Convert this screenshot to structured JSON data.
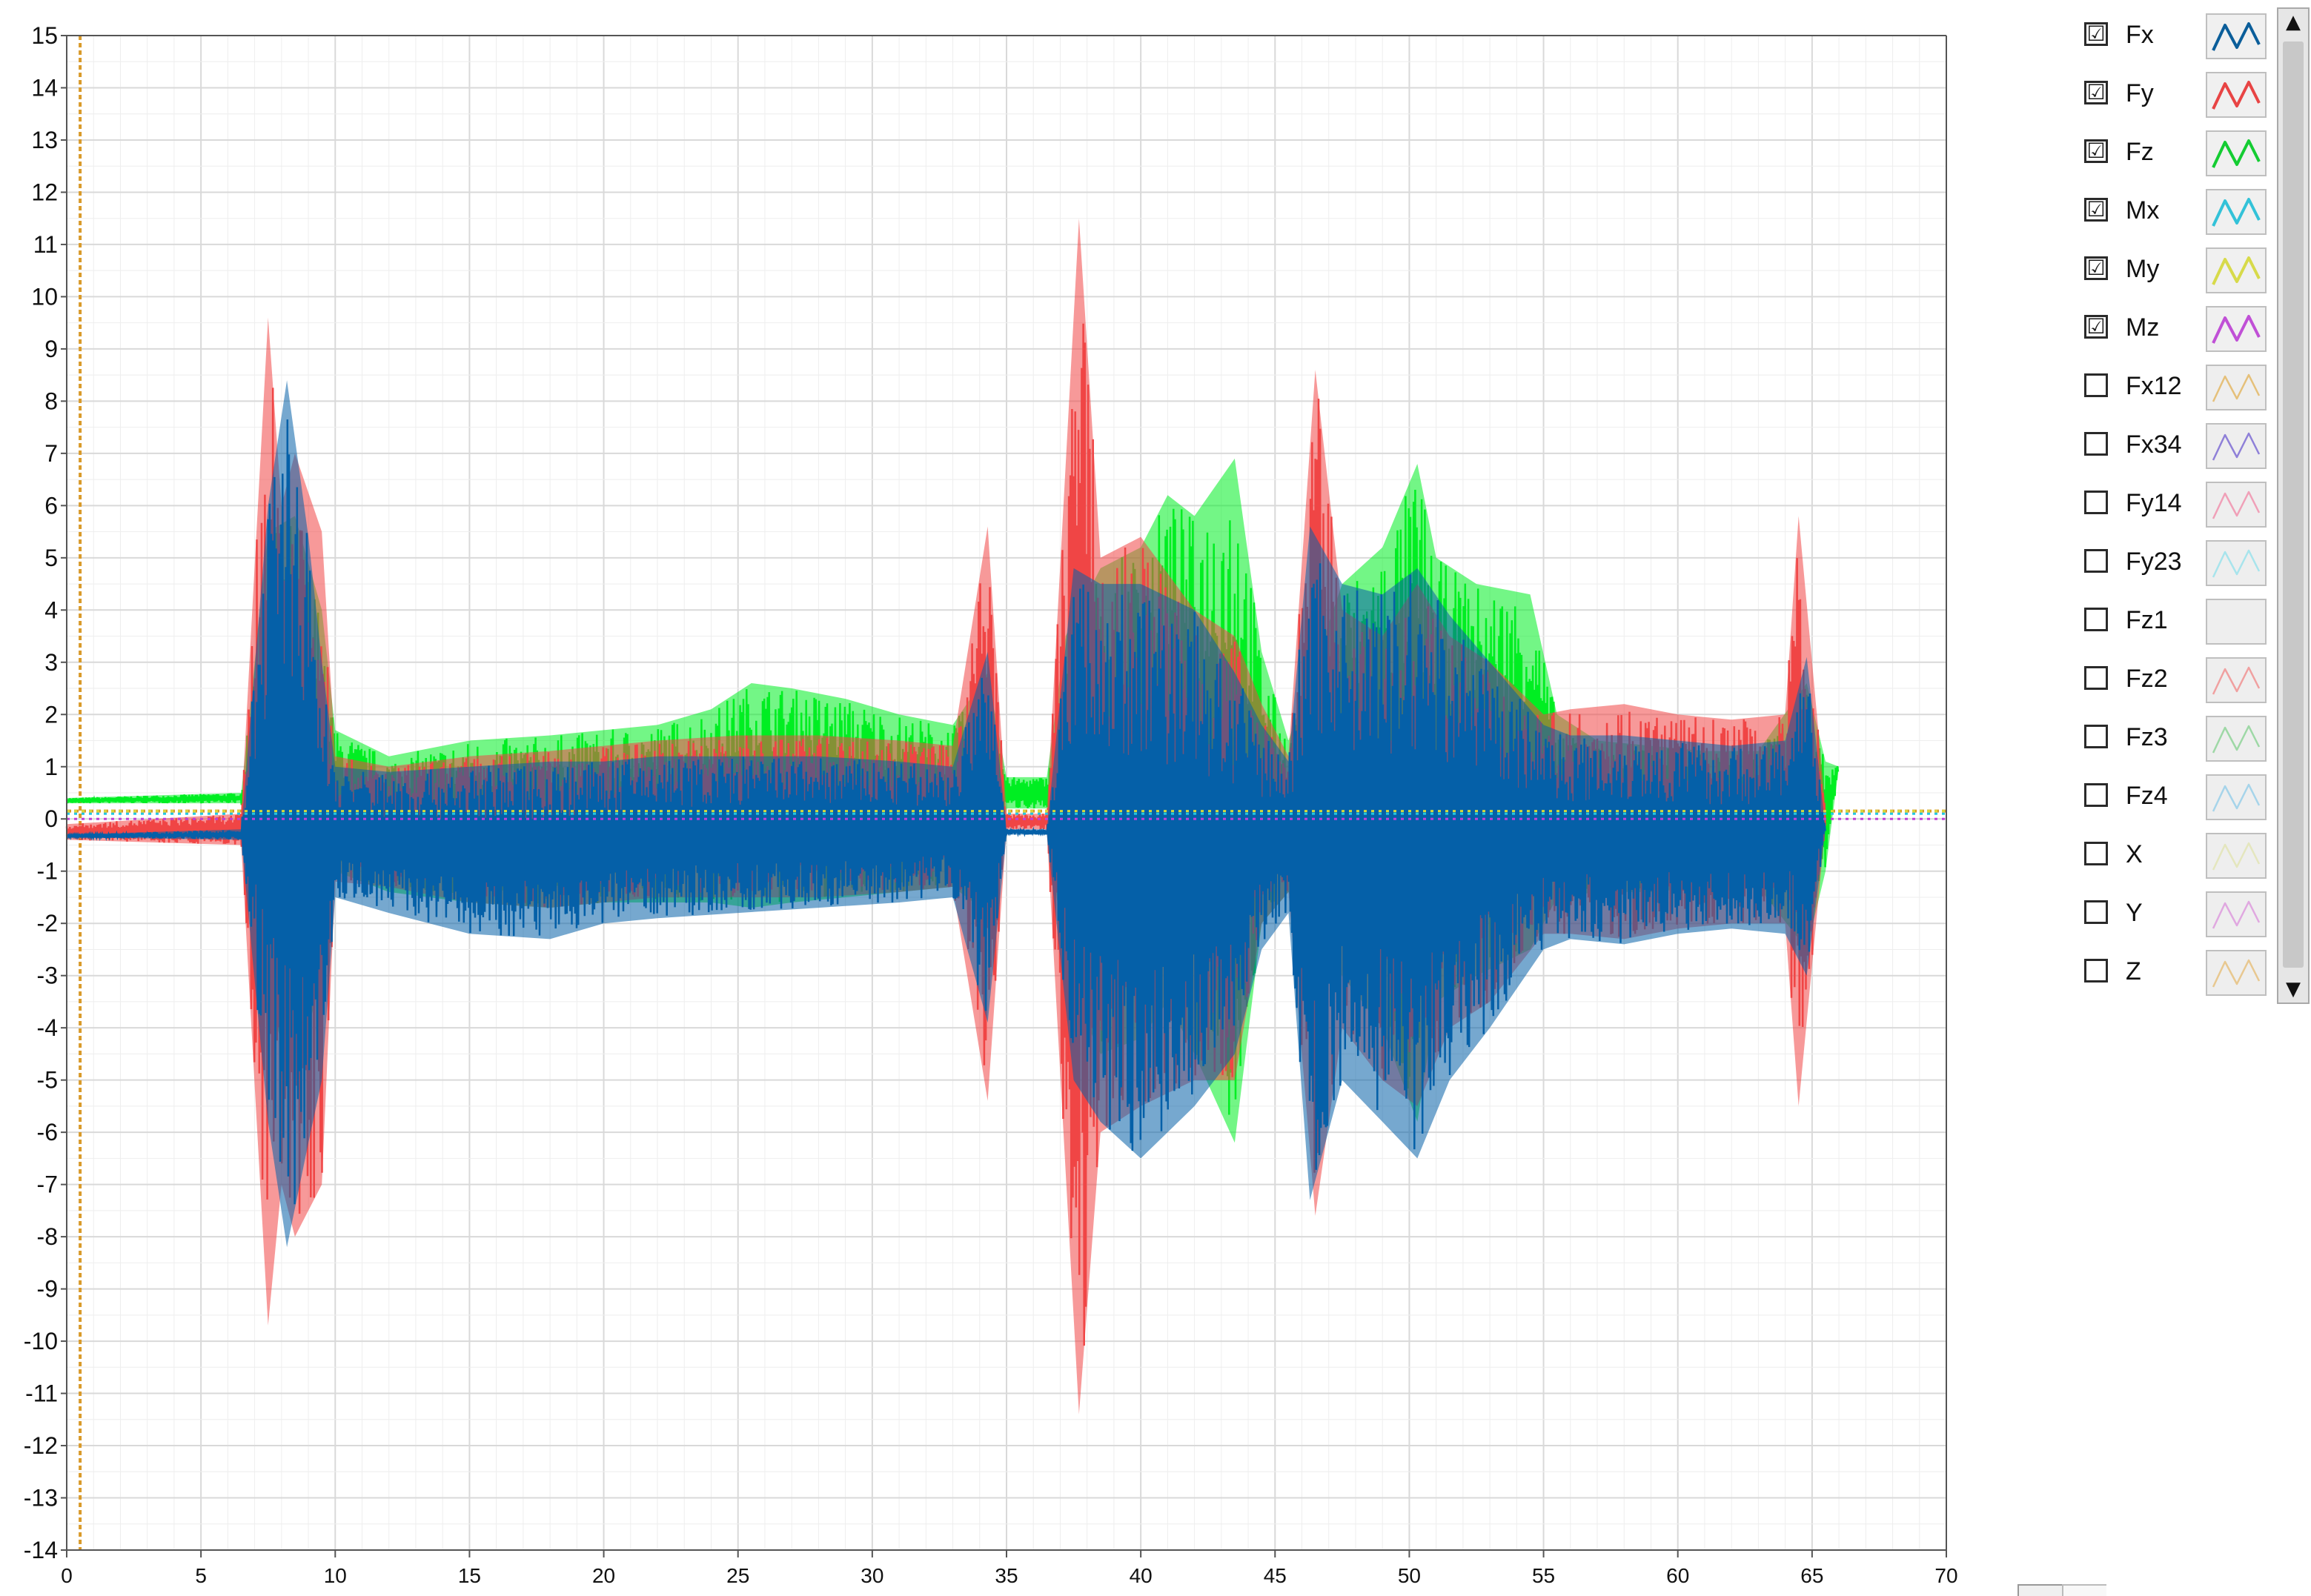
{
  "chart_data": {
    "type": "line",
    "title": "",
    "xlabel": "",
    "ylabel": "",
    "xlim": [
      0,
      70
    ],
    "ylim": [
      -14,
      15
    ],
    "x_ticks": [
      "0",
      "5",
      "10",
      "15",
      "20",
      "25",
      "30",
      "35",
      "40",
      "45",
      "50",
      "55",
      "60",
      "65",
      "70"
    ],
    "y_ticks": [
      "15",
      "14",
      "13",
      "12",
      "11",
      "10",
      "9",
      "8",
      "7",
      "6",
      "5",
      "4",
      "3",
      "2",
      "1",
      "0",
      "-1",
      "-2",
      "-3",
      "-4",
      "-5",
      "-6",
      "-7",
      "-8",
      "-9",
      "-10",
      "-11",
      "-12",
      "-13",
      "-14"
    ],
    "grid": true,
    "legend_position": "right",
    "series": [
      {
        "name": "Fz",
        "color": "#00ee22",
        "x": [
          0,
          6.5,
          7.5,
          8.5,
          9.5,
          10,
          12,
          15,
          18,
          20,
          22,
          24,
          25.5,
          27,
          29,
          31,
          33,
          34.3,
          35,
          36.5,
          37.2,
          38.5,
          40,
          41,
          42,
          43.5,
          44.5,
          45.5,
          46.5,
          47.5,
          49,
          50.3,
          51,
          52.5,
          54.5,
          55.5,
          57,
          59,
          61,
          63,
          64.8,
          65.5,
          66
        ],
        "upper": [
          0.4,
          0.5,
          5.5,
          5.8,
          4.0,
          1.7,
          1.2,
          1.5,
          1.6,
          1.7,
          1.8,
          2.1,
          2.6,
          2.5,
          2.3,
          2.0,
          1.8,
          2.8,
          0.8,
          0.8,
          3.5,
          4.8,
          5.2,
          6.2,
          5.8,
          6.9,
          3.2,
          1.5,
          3.0,
          4.5,
          5.2,
          6.8,
          5.0,
          4.5,
          4.3,
          2.0,
          1.5,
          1.4,
          1.3,
          1.3,
          2.6,
          1.1,
          1.0
        ],
        "lower": [
          0.3,
          0.3,
          -3.5,
          -5.0,
          -3.0,
          -1.0,
          -1.4,
          -1.6,
          -1.7,
          -1.6,
          -1.6,
          -1.6,
          -1.7,
          -1.6,
          -1.5,
          -1.4,
          -1.3,
          -1.8,
          0.2,
          0.2,
          -3.0,
          -4.5,
          -4.2,
          -3.5,
          -4.5,
          -6.2,
          -2.0,
          -1.4,
          -2.5,
          -3.0,
          -4.0,
          -5.8,
          -3.5,
          -3.0,
          -2.5,
          -1.5,
          -1.4,
          -1.4,
          -1.3,
          -1.3,
          -2.5,
          -1.0,
          1.0
        ]
      },
      {
        "name": "Fy",
        "color": "#f04545",
        "x": [
          0,
          6.5,
          7.5,
          8,
          8.5,
          9.5,
          10,
          12,
          15,
          18,
          20,
          22,
          25,
          28,
          31,
          33,
          34.3,
          35,
          36.5,
          37.7,
          38.5,
          40,
          42,
          43.5,
          44.5,
          45.5,
          46.5,
          47.5,
          49,
          50.3,
          51.5,
          53,
          55,
          56,
          58,
          60,
          62,
          64,
          64.5,
          65.5
        ],
        "upper": [
          -0.1,
          0.1,
          9.6,
          6.0,
          7.0,
          5.5,
          1.2,
          1.0,
          1.2,
          1.3,
          1.4,
          1.5,
          1.6,
          1.6,
          1.5,
          1.4,
          5.6,
          0.1,
          0.1,
          11.5,
          5.0,
          5.4,
          4.0,
          3.5,
          2.2,
          1.2,
          8.6,
          4.0,
          3.5,
          4.5,
          3.5,
          3.0,
          2.0,
          2.1,
          2.2,
          2.0,
          1.9,
          2.0,
          5.8,
          0.2
        ],
        "lower": [
          -0.4,
          -0.5,
          -9.7,
          -7.0,
          -8.0,
          -7.0,
          -1.2,
          -1.3,
          -1.6,
          -1.7,
          -1.6,
          -1.5,
          -1.5,
          -1.5,
          -1.4,
          -1.3,
          -5.4,
          -0.2,
          -0.2,
          -11.4,
          -6.0,
          -5.5,
          -5.0,
          -5.0,
          -2.0,
          -1.4,
          -7.6,
          -4.0,
          -5.0,
          -5.5,
          -4.0,
          -3.5,
          -2.2,
          -2.2,
          -2.3,
          -2.1,
          -2.0,
          -2.0,
          -5.5,
          -0.1
        ]
      },
      {
        "name": "Fx",
        "color": "#0660a8",
        "x": [
          0,
          6.5,
          7.5,
          8.2,
          9,
          9.5,
          10,
          12,
          15,
          18,
          20,
          22,
          25,
          28,
          31,
          33,
          34.3,
          35,
          36.5,
          37.5,
          38.5,
          40,
          42,
          43.5,
          44.5,
          45.5,
          46.3,
          47.5,
          49,
          50.3,
          51.5,
          53,
          55,
          56,
          58,
          60,
          62,
          64,
          64.8,
          65.5
        ],
        "upper": [
          -0.3,
          -0.2,
          6.0,
          8.4,
          5.4,
          3.0,
          1.0,
          0.9,
          1.0,
          1.1,
          1.1,
          1.2,
          1.2,
          1.2,
          1.1,
          1.0,
          3.2,
          -0.2,
          -0.2,
          4.8,
          4.5,
          4.5,
          4.0,
          2.8,
          1.8,
          1.1,
          5.6,
          4.5,
          4.3,
          4.8,
          3.9,
          3.0,
          1.8,
          1.6,
          1.6,
          1.5,
          1.4,
          1.5,
          3.1,
          -0.2
        ],
        "lower": [
          -0.35,
          -0.4,
          -5.8,
          -8.2,
          -6.2,
          -5.0,
          -1.5,
          -1.8,
          -2.2,
          -2.3,
          -2.0,
          -1.9,
          -1.8,
          -1.7,
          -1.6,
          -1.5,
          -3.9,
          -0.3,
          -0.3,
          -5.0,
          -5.8,
          -6.5,
          -5.5,
          -4.5,
          -2.5,
          -1.8,
          -7.3,
          -5.0,
          -5.8,
          -6.5,
          -5.0,
          -4.0,
          -2.5,
          -2.3,
          -2.4,
          -2.2,
          -2.1,
          -2.2,
          -3.0,
          -0.2
        ]
      },
      {
        "name": "Mx",
        "color": "#22c8e0",
        "x": [
          0,
          70
        ],
        "upper": [
          0.1,
          0.1
        ],
        "lower": [
          0.1,
          0.1
        ]
      },
      {
        "name": "My",
        "color": "#d7d83a",
        "x": [
          0,
          70
        ],
        "upper": [
          0.15,
          0.15
        ],
        "lower": [
          0.15,
          0.15
        ]
      },
      {
        "name": "Mz",
        "color": "#c040d8",
        "x": [
          0,
          70
        ],
        "upper": [
          0.0,
          0.0
        ],
        "lower": [
          0.0,
          0.0
        ]
      }
    ]
  },
  "legend": {
    "items": [
      {
        "label": "Fx",
        "checked": true,
        "check_glyph": "☑",
        "color": "#0b5e9a",
        "swatch_bg": "#f0f0f0",
        "icon": "wave-swatch-icon"
      },
      {
        "label": "Fy",
        "checked": true,
        "check_glyph": "☑",
        "color": "#e84444",
        "swatch_bg": "#f0f0f0",
        "icon": "wave-swatch-icon"
      },
      {
        "label": "Fz",
        "checked": true,
        "check_glyph": "☑",
        "color": "#14cc32",
        "swatch_bg": "#f0f0f0",
        "icon": "wave-swatch-icon"
      },
      {
        "label": "Mx",
        "checked": true,
        "check_glyph": "☑",
        "color": "#33c2d8",
        "swatch_bg": "#f0f0f0",
        "icon": "wave-swatch-icon"
      },
      {
        "label": "My",
        "checked": true,
        "check_glyph": "☑",
        "color": "#d7da4a",
        "swatch_bg": "#f0f0f0",
        "icon": "wave-swatch-icon"
      },
      {
        "label": "Mz",
        "checked": true,
        "check_glyph": "☑",
        "color": "#c050d6",
        "swatch_bg": "#f0f0f0",
        "icon": "wave-swatch-icon"
      },
      {
        "label": "Fx12",
        "checked": false,
        "check_glyph": "",
        "color": "#e5c07a",
        "swatch_bg": "#eeeeee",
        "icon": "wave-swatch-icon"
      },
      {
        "label": "Fx34",
        "checked": false,
        "check_glyph": "",
        "color": "#8f80d8",
        "swatch_bg": "#eeeeee",
        "icon": "wave-swatch-icon"
      },
      {
        "label": "Fy14",
        "checked": false,
        "check_glyph": "",
        "color": "#f0a0b8",
        "swatch_bg": "#eeeeee",
        "icon": "wave-swatch-icon"
      },
      {
        "label": "Fy23",
        "checked": false,
        "check_glyph": "",
        "color": "#a8e4ec",
        "swatch_bg": "#eeeeee",
        "icon": "wave-swatch-icon"
      },
      {
        "label": "Fz1",
        "checked": false,
        "check_glyph": "",
        "color": "#eeeeee",
        "swatch_bg": "#eeeeee",
        "icon": "wave-swatch-icon"
      },
      {
        "label": "Fz2",
        "checked": false,
        "check_glyph": "",
        "color": "#f0a0a0",
        "swatch_bg": "#eeeeee",
        "icon": "wave-swatch-icon"
      },
      {
        "label": "Fz3",
        "checked": false,
        "check_glyph": "",
        "color": "#9ed8a6",
        "swatch_bg": "#eeeeee",
        "icon": "wave-swatch-icon"
      },
      {
        "label": "Fz4",
        "checked": false,
        "check_glyph": "",
        "color": "#a6d4ea",
        "swatch_bg": "#eeeeee",
        "icon": "wave-swatch-icon"
      },
      {
        "label": "X",
        "checked": false,
        "check_glyph": "",
        "color": "#e4e6be",
        "swatch_bg": "#eeeeee",
        "icon": "wave-swatch-icon"
      },
      {
        "label": "Y",
        "checked": false,
        "check_glyph": "",
        "color": "#e0a8e0",
        "swatch_bg": "#eeeeee",
        "icon": "wave-swatch-icon"
      },
      {
        "label": "Z",
        "checked": false,
        "check_glyph": "",
        "color": "#e8c890",
        "swatch_bg": "#eeeeee",
        "icon": "wave-swatch-icon"
      }
    ],
    "scroll_up_glyph": "▲",
    "scroll_down_glyph": "▼"
  },
  "colors": {
    "cursor_line": "#d99a2a",
    "grid_major": "#d9d9d9",
    "grid_minor": "#eeeeee",
    "axis": "#555555"
  }
}
